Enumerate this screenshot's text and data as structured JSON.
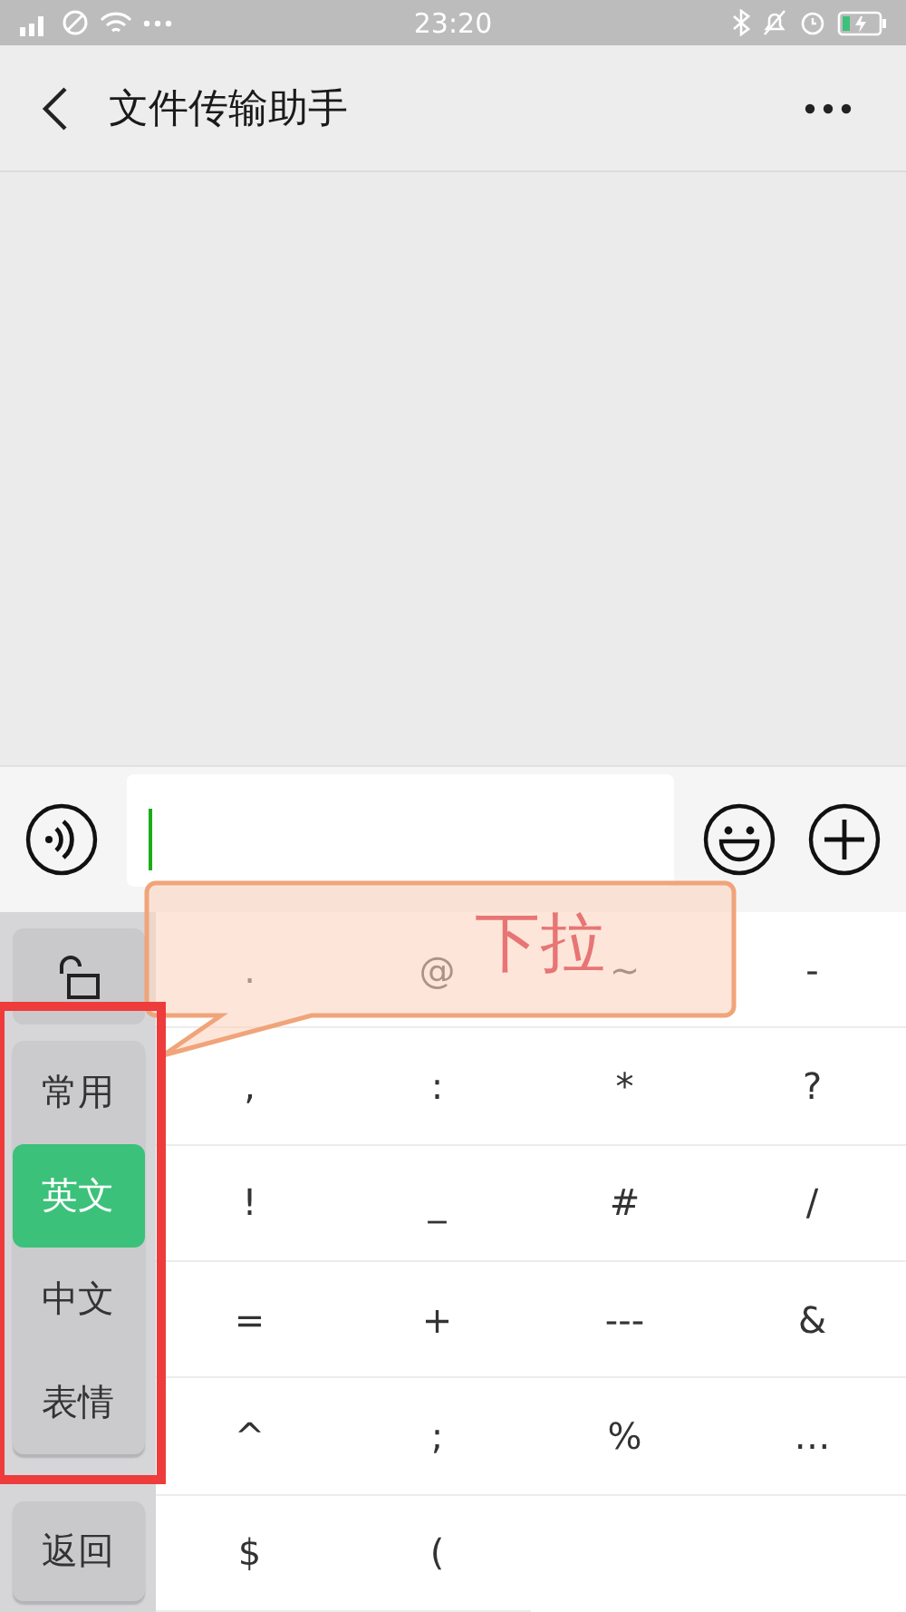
{
  "status_bar": {
    "time": "23:20"
  },
  "header": {
    "title": "文件传输助手"
  },
  "keyboard": {
    "categories": [
      {
        "label": "常用",
        "selected": false
      },
      {
        "label": "英文",
        "selected": true
      },
      {
        "label": "中文",
        "selected": false
      },
      {
        "label": "表情",
        "selected": false
      }
    ],
    "back_label": "返回",
    "rows": [
      [
        ".",
        "@",
        "~",
        "-"
      ],
      [
        ",",
        ":",
        "*",
        "?"
      ],
      [
        "!",
        "_",
        "#",
        "/"
      ],
      [
        "=",
        "+",
        "---",
        "&"
      ],
      [
        "^",
        ";",
        "%",
        "…"
      ],
      [
        "$",
        "("
      ]
    ]
  },
  "annotation": {
    "callout_text": "下拉"
  }
}
